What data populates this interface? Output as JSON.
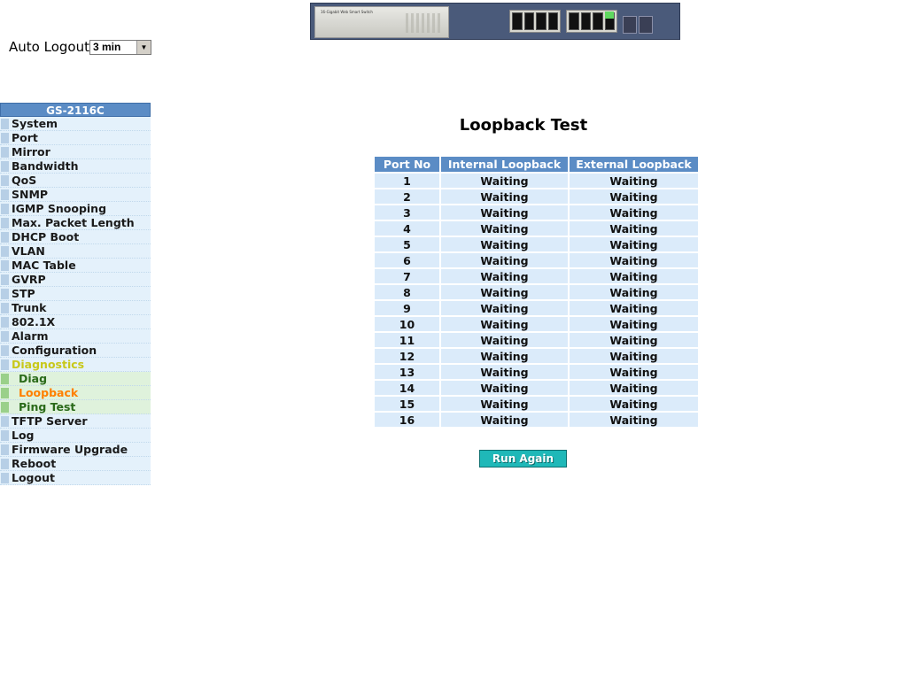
{
  "header": {
    "banner_model_text": "16-Gigabit Web Smart Switch"
  },
  "auto_logout": {
    "label": "Auto Logout",
    "selected": "3 min"
  },
  "sidebar": {
    "title": "GS-2116C",
    "items": [
      {
        "label": "System"
      },
      {
        "label": "Port"
      },
      {
        "label": "Mirror"
      },
      {
        "label": "Bandwidth"
      },
      {
        "label": "QoS"
      },
      {
        "label": "SNMP"
      },
      {
        "label": "IGMP Snooping"
      },
      {
        "label": "Max. Packet Length"
      },
      {
        "label": "DHCP Boot"
      },
      {
        "label": "VLAN"
      },
      {
        "label": "MAC Table"
      },
      {
        "label": "GVRP"
      },
      {
        "label": "STP"
      },
      {
        "label": "Trunk"
      },
      {
        "label": "802.1X"
      },
      {
        "label": "Alarm"
      },
      {
        "label": "Configuration"
      },
      {
        "label": "Diagnostics",
        "state": "open"
      },
      {
        "label": "Diag",
        "sub": true
      },
      {
        "label": "Loopback",
        "sub": true,
        "state": "active"
      },
      {
        "label": "Ping Test",
        "sub": true
      },
      {
        "label": "TFTP Server"
      },
      {
        "label": "Log"
      },
      {
        "label": "Firmware Upgrade"
      },
      {
        "label": "Reboot"
      },
      {
        "label": "Logout"
      }
    ]
  },
  "main": {
    "title": "Loopback Test",
    "columns": [
      "Port No",
      "Internal Loopback",
      "External Loopback"
    ],
    "rows": [
      [
        "1",
        "Waiting",
        "Waiting"
      ],
      [
        "2",
        "Waiting",
        "Waiting"
      ],
      [
        "3",
        "Waiting",
        "Waiting"
      ],
      [
        "4",
        "Waiting",
        "Waiting"
      ],
      [
        "5",
        "Waiting",
        "Waiting"
      ],
      [
        "6",
        "Waiting",
        "Waiting"
      ],
      [
        "7",
        "Waiting",
        "Waiting"
      ],
      [
        "8",
        "Waiting",
        "Waiting"
      ],
      [
        "9",
        "Waiting",
        "Waiting"
      ],
      [
        "10",
        "Waiting",
        "Waiting"
      ],
      [
        "11",
        "Waiting",
        "Waiting"
      ],
      [
        "12",
        "Waiting",
        "Waiting"
      ],
      [
        "13",
        "Waiting",
        "Waiting"
      ],
      [
        "14",
        "Waiting",
        "Waiting"
      ],
      [
        "15",
        "Waiting",
        "Waiting"
      ],
      [
        "16",
        "Waiting",
        "Waiting"
      ]
    ],
    "run_button": "Run Again"
  },
  "colors": {
    "header_blue": "#5b8cc5",
    "row_blue": "#dbebfa",
    "menu_bg": "#e4f1fb",
    "submenu_bg": "#dff2dc",
    "open_menu": "#c8c81a",
    "active_menu": "#ff7f00",
    "button": "#1fb8b8"
  }
}
